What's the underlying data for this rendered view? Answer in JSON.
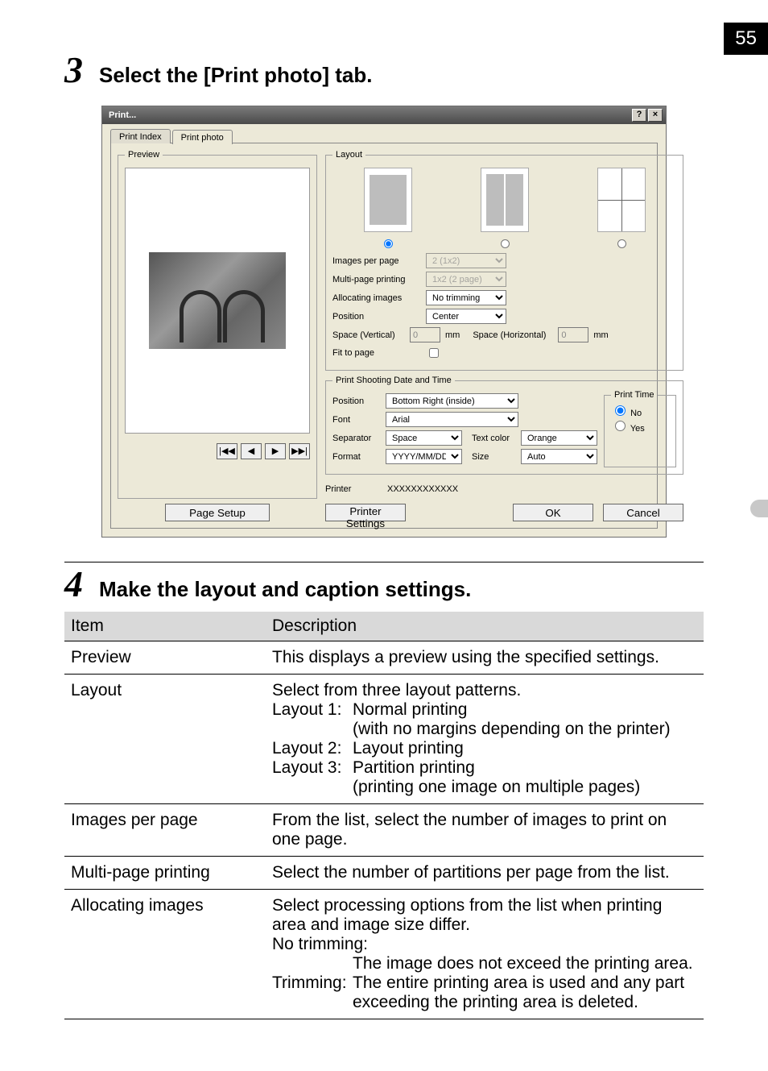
{
  "page_number": "55",
  "step3": {
    "number": "3",
    "title": "Select the [Print photo] tab."
  },
  "step4": {
    "number": "4",
    "title": "Make the layout and caption settings."
  },
  "dialog": {
    "title": "Print...",
    "help_btn": "?",
    "close_btn": "×",
    "tabs": {
      "index": "Print Index",
      "photo": "Print photo"
    },
    "preview_legend": "Preview",
    "nav": {
      "first": "|◀◀",
      "prev": "◀",
      "next": "▶",
      "last": "▶▶|"
    },
    "page_setup": "Page Setup",
    "layout": {
      "legend": "Layout",
      "images_per_page_label": "Images per page",
      "images_per_page_value": "2 (1x2)",
      "multi_page_label": "Multi-page printing",
      "multi_page_value": "1x2 (2 page)",
      "allocating_label": "Allocating images",
      "allocating_value": "No trimming",
      "position_label": "Position",
      "position_value": "Center",
      "space_v_label": "Space (Vertical)",
      "space_v_value": "0",
      "space_h_label": "Space (Horizontal)",
      "space_h_value": "0",
      "unit": "mm",
      "fit_label": "Fit to page"
    },
    "datetime": {
      "legend": "Print Shooting Date and Time",
      "position_label": "Position",
      "position_value": "Bottom Right (inside)",
      "font_label": "Font",
      "font_value": "Arial",
      "separator_label": "Separator",
      "separator_value": "Space",
      "textcolor_label": "Text color",
      "textcolor_value": "Orange",
      "format_label": "Format",
      "format_value": "YYYY/MM/DD",
      "size_label": "Size",
      "size_value": "Auto",
      "printtime_legend": "Print Time",
      "pt_no": "No",
      "pt_yes": "Yes"
    },
    "footer": {
      "printer_label": "Printer",
      "printer_name": "XXXXXXXXXXXX",
      "printer_settings": "Printer Settings",
      "ok": "OK",
      "cancel": "Cancel"
    }
  },
  "table": {
    "h_item": "Item",
    "h_desc": "Description",
    "rows": {
      "preview": {
        "item": "Preview",
        "desc": "This displays a preview using the specified settings."
      },
      "layout": {
        "item": "Layout",
        "intro": "Select from three layout patterns.",
        "l1k": "Layout 1:",
        "l1v": "Normal printing",
        "l1v2": "(with no margins depending on the printer)",
        "l2k": "Layout 2:",
        "l2v": "Layout printing",
        "l3k": "Layout 3:",
        "l3v": "Partition printing",
        "l3v2": "(printing one image on multiple pages)"
      },
      "ipp": {
        "item": "Images per page",
        "desc": "From the list, select the number of images to print on one page."
      },
      "mpp": {
        "item": "Multi-page printing",
        "desc": "Select the number of partitions per page from the list."
      },
      "alloc": {
        "item": "Allocating images",
        "intro": "Select processing options from the list when printing area and image size differ.",
        "nk": "No trimming:",
        "nv": "The image does not exceed the printing area.",
        "tk": "Trimming:",
        "tv": "The entire printing area is used and any part exceeding the printing area is deleted."
      }
    }
  }
}
